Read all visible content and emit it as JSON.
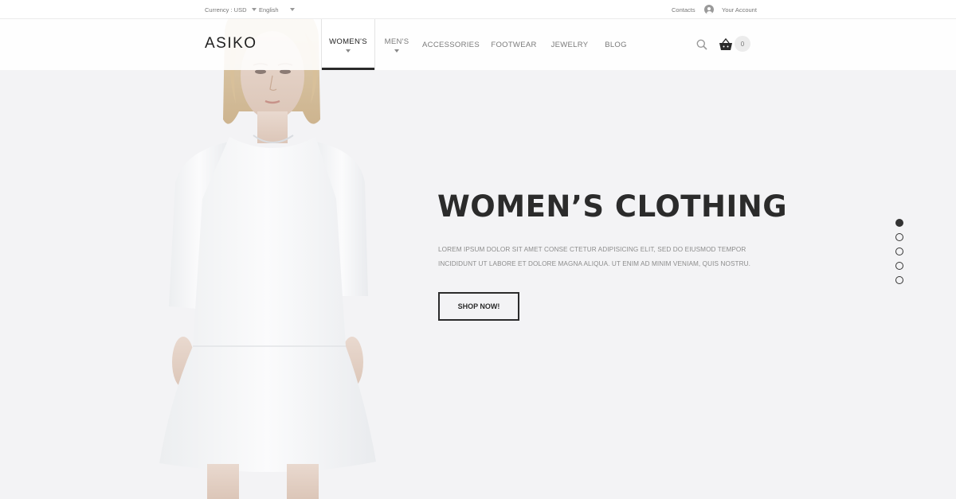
{
  "topbar": {
    "currency": "Currency : USD",
    "language": "English",
    "contacts": "Contacts",
    "account": "Your Account"
  },
  "header": {
    "logo": "ASIKO",
    "nav": [
      {
        "label": "WOMEN'S",
        "active": true,
        "dropdown": true
      },
      {
        "label": "MEN'S",
        "active": false,
        "dropdown": true
      },
      {
        "label": "ACCESSORIES",
        "active": false,
        "dropdown": false
      },
      {
        "label": "FOOTWEAR",
        "active": false,
        "dropdown": false
      },
      {
        "label": "JEWELRY",
        "active": false,
        "dropdown": false
      },
      {
        "label": "BLOG",
        "active": false,
        "dropdown": false
      }
    ],
    "cart_count": "0",
    "icons": [
      "search-icon",
      "basket-icon",
      "user-icon"
    ]
  },
  "hero": {
    "title": "WOMEN’S CLOTHING",
    "text": "LOREM IPSUM DOLOR SIT AMET CONSE CTETUR ADIPISICING ELIT, SED DO EIUSMOD TEMPOR INCIDIDUNT UT LABORE ET DOLORE MAGNA ALIQUA. UT ENIM AD MINIM VENIAM, QUIS NOSTRU.",
    "button": "SHOP NOW!",
    "slides_total": 5,
    "slide_active": 1
  },
  "colors": {
    "background": "#f3f3f5",
    "text_dark": "#2b2b2b",
    "text_muted": "#8c8c8c",
    "accent": "#2a2a2a"
  }
}
